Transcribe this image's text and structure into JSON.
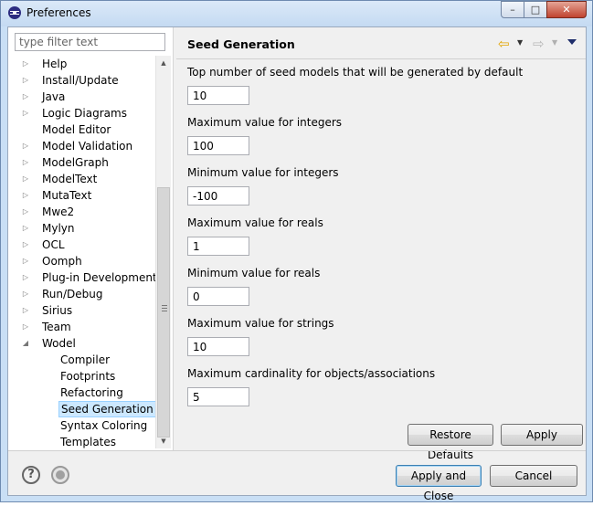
{
  "window": {
    "title": "Preferences",
    "minimize": "–",
    "maximize": "□",
    "close": "✕"
  },
  "filter": {
    "placeholder": "type filter text"
  },
  "tree": [
    {
      "label": "Help",
      "indent": 0,
      "expander": "collapsed"
    },
    {
      "label": "Install/Update",
      "indent": 0,
      "expander": "collapsed"
    },
    {
      "label": "Java",
      "indent": 0,
      "expander": "collapsed"
    },
    {
      "label": "Logic Diagrams",
      "indent": 0,
      "expander": "collapsed"
    },
    {
      "label": "Model Editor",
      "indent": 0,
      "expander": "none"
    },
    {
      "label": "Model Validation",
      "indent": 0,
      "expander": "collapsed"
    },
    {
      "label": "ModelGraph",
      "indent": 0,
      "expander": "collapsed"
    },
    {
      "label": "ModelText",
      "indent": 0,
      "expander": "collapsed"
    },
    {
      "label": "MutaText",
      "indent": 0,
      "expander": "collapsed"
    },
    {
      "label": "Mwe2",
      "indent": 0,
      "expander": "collapsed"
    },
    {
      "label": "Mylyn",
      "indent": 0,
      "expander": "collapsed"
    },
    {
      "label": "OCL",
      "indent": 0,
      "expander": "collapsed"
    },
    {
      "label": "Oomph",
      "indent": 0,
      "expander": "collapsed"
    },
    {
      "label": "Plug-in Development",
      "indent": 0,
      "expander": "collapsed"
    },
    {
      "label": "Run/Debug",
      "indent": 0,
      "expander": "collapsed"
    },
    {
      "label": "Sirius",
      "indent": 0,
      "expander": "collapsed"
    },
    {
      "label": "Team",
      "indent": 0,
      "expander": "collapsed"
    },
    {
      "label": "Wodel",
      "indent": 0,
      "expander": "expanded"
    },
    {
      "label": "Compiler",
      "indent": 1,
      "expander": "none"
    },
    {
      "label": "Footprints",
      "indent": 1,
      "expander": "none"
    },
    {
      "label": "Refactoring",
      "indent": 1,
      "expander": "none"
    },
    {
      "label": "Seed Generation",
      "indent": 1,
      "expander": "none",
      "selected": true
    },
    {
      "label": "Syntax Coloring",
      "indent": 1,
      "expander": "none"
    },
    {
      "label": "Templates",
      "indent": 1,
      "expander": "none"
    }
  ],
  "page": {
    "title": "Seed Generation",
    "fields": [
      {
        "label": "Top number of seed models that will be generated by default",
        "value": "10"
      },
      {
        "label": "Maximum value for integers",
        "value": "100"
      },
      {
        "label": "Minimum value for integers",
        "value": "-100"
      },
      {
        "label": "Maximum value for reals",
        "value": "1"
      },
      {
        "label": "Minimum value for reals",
        "value": "0"
      },
      {
        "label": "Maximum value for strings",
        "value": "10"
      },
      {
        "label": "Maximum cardinality for objects/associations",
        "value": "5"
      }
    ],
    "restore_defaults": "Restore Defaults",
    "apply": "Apply"
  },
  "footer": {
    "help_icon": "?",
    "apply_and_close": "Apply and Close",
    "cancel": "Cancel"
  },
  "colors": {
    "selection_bg": "#cce8ff",
    "back_arrow": "#e2a400",
    "dialog_bg": "#f0f0f0"
  }
}
